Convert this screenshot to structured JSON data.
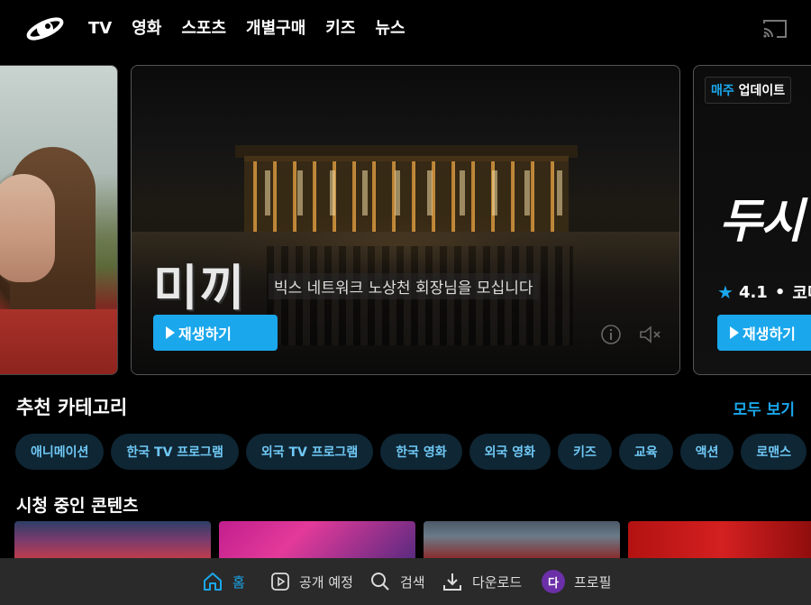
{
  "nav": {
    "items": [
      "TV",
      "영화",
      "스포츠",
      "개별구매",
      "키즈",
      "뉴스"
    ]
  },
  "hero": {
    "main": {
      "title": "미끼",
      "subtitle": "빅스 네트워크 노상천 회장님을 모십니다",
      "play_label": "재생하기"
    },
    "right": {
      "badge_accent": "매주",
      "badge_rest": " 업데이트",
      "title": "두시",
      "rating": "4.1",
      "genre": "코미",
      "play_label": "재생하기"
    }
  },
  "recommended": {
    "title": "추천 카테고리",
    "see_all": "모두 보기",
    "chips": [
      "애니메이션",
      "한국 TV 프로그램",
      "외국 TV 프로그램",
      "한국 영화",
      "외국 영화",
      "키즈",
      "교육",
      "액션",
      "로맨스"
    ]
  },
  "continue_watching": {
    "title": "시청 중인 콘텐츠"
  },
  "bottom_nav": {
    "home": "홈",
    "upcoming": "공개 예정",
    "search": "검색",
    "download": "다운로드",
    "profile_initial": "다",
    "profile": "프로필"
  },
  "colors": {
    "accent": "#1aa7ec",
    "background": "#000000",
    "chip_bg": "#0f2634",
    "bottom_bar": "#2a2a2a"
  }
}
